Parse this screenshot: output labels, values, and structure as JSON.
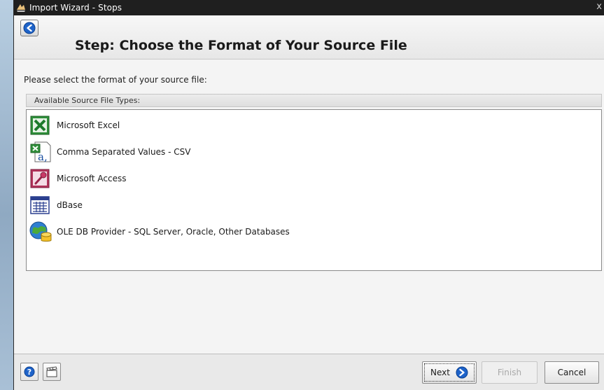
{
  "window": {
    "title": "Import Wizard - Stops",
    "close_glyph": "x"
  },
  "header": {
    "step_title": "Step:  Choose the Format of Your Source File",
    "back_icon": "back-arrow-icon"
  },
  "main": {
    "prompt": "Please select the format of your source file:",
    "panel_title": "Available Source File Types:",
    "file_types": [
      {
        "label": "Microsoft Excel",
        "icon": "excel-icon"
      },
      {
        "label": "Comma Separated Values - CSV",
        "icon": "csv-icon"
      },
      {
        "label": "Microsoft Access",
        "icon": "access-icon"
      },
      {
        "label": "dBase",
        "icon": "dbase-icon"
      },
      {
        "label": "OLE DB Provider - SQL Server, Oracle, Other Databases",
        "icon": "oledb-icon"
      }
    ]
  },
  "footer": {
    "help_icon": "help-icon",
    "clapper_icon": "clapperboard-icon",
    "next_label": "Next",
    "finish_label": "Finish",
    "cancel_label": "Cancel"
  },
  "colors": {
    "titlebar": "#1f1f1f",
    "accent_blue": "#1e63c9",
    "window_bg": "#f4f4f4"
  }
}
